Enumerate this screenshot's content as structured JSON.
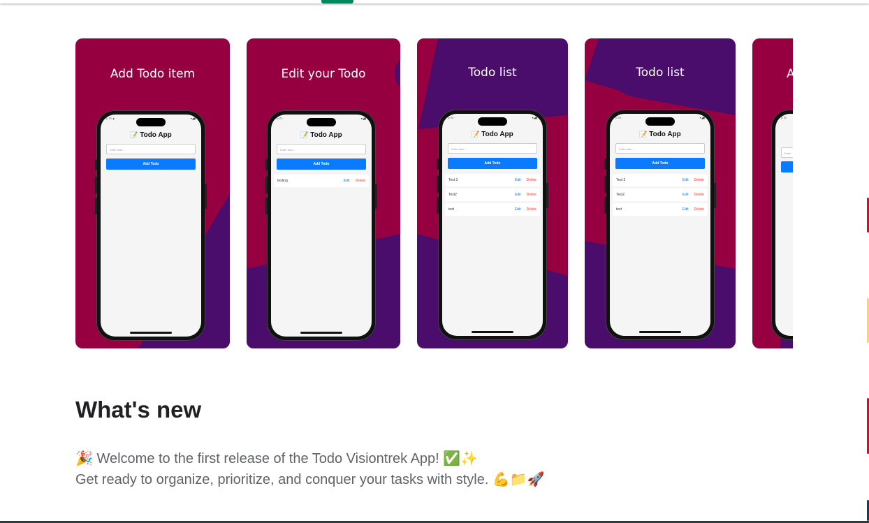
{
  "screenshots": [
    {
      "caption": "Add Todo item",
      "app_title": "Todo App",
      "input_placeholder": "Enter todo...",
      "add_button": "Add Todo",
      "items": []
    },
    {
      "caption": "Edit your Todo",
      "app_title": "Todo App",
      "input_placeholder": "Enter todo...",
      "add_button": "Add Todo",
      "items": [
        {
          "text": "testing",
          "edit": "Edit",
          "delete": "Delete"
        }
      ]
    },
    {
      "caption": "Todo list",
      "app_title": "Todo App",
      "input_placeholder": "Enter todo...",
      "add_button": "Add Todo",
      "items": [
        {
          "text": "Test 3",
          "edit": "Edit",
          "delete": "Delete"
        },
        {
          "text": "Test2",
          "edit": "Edit",
          "delete": "Delete"
        },
        {
          "text": "test",
          "edit": "Edit",
          "delete": "Delete"
        }
      ]
    },
    {
      "caption": "Todo list",
      "app_title": "Todo App",
      "input_placeholder": "Enter todo...",
      "add_button": "Add Todo",
      "items": [
        {
          "text": "Test 3",
          "edit": "Edit",
          "delete": "Delete"
        },
        {
          "text": "Test2",
          "edit": "Edit",
          "delete": "Delete"
        },
        {
          "text": "test",
          "edit": "Edit",
          "delete": "Delete"
        }
      ]
    },
    {
      "caption": "A",
      "app_title": "",
      "input_placeholder": "Enter",
      "add_button": "",
      "items": []
    }
  ],
  "whats_new": {
    "title": "What's new",
    "line1": "🎉 Welcome to the first release of the Todo Visiontrek App! ✅✨",
    "line2": "Get ready to organize, prioritize, and conquer your tasks with style. 💪📁🚀"
  },
  "colors": {
    "crimson": "#960040",
    "purple": "#4a0d6b",
    "accent_green": "#01875f",
    "button_blue": "#0a7aff",
    "delete_red": "#ff3b30"
  },
  "icons": {
    "app_title_icon": "memo-icon"
  }
}
